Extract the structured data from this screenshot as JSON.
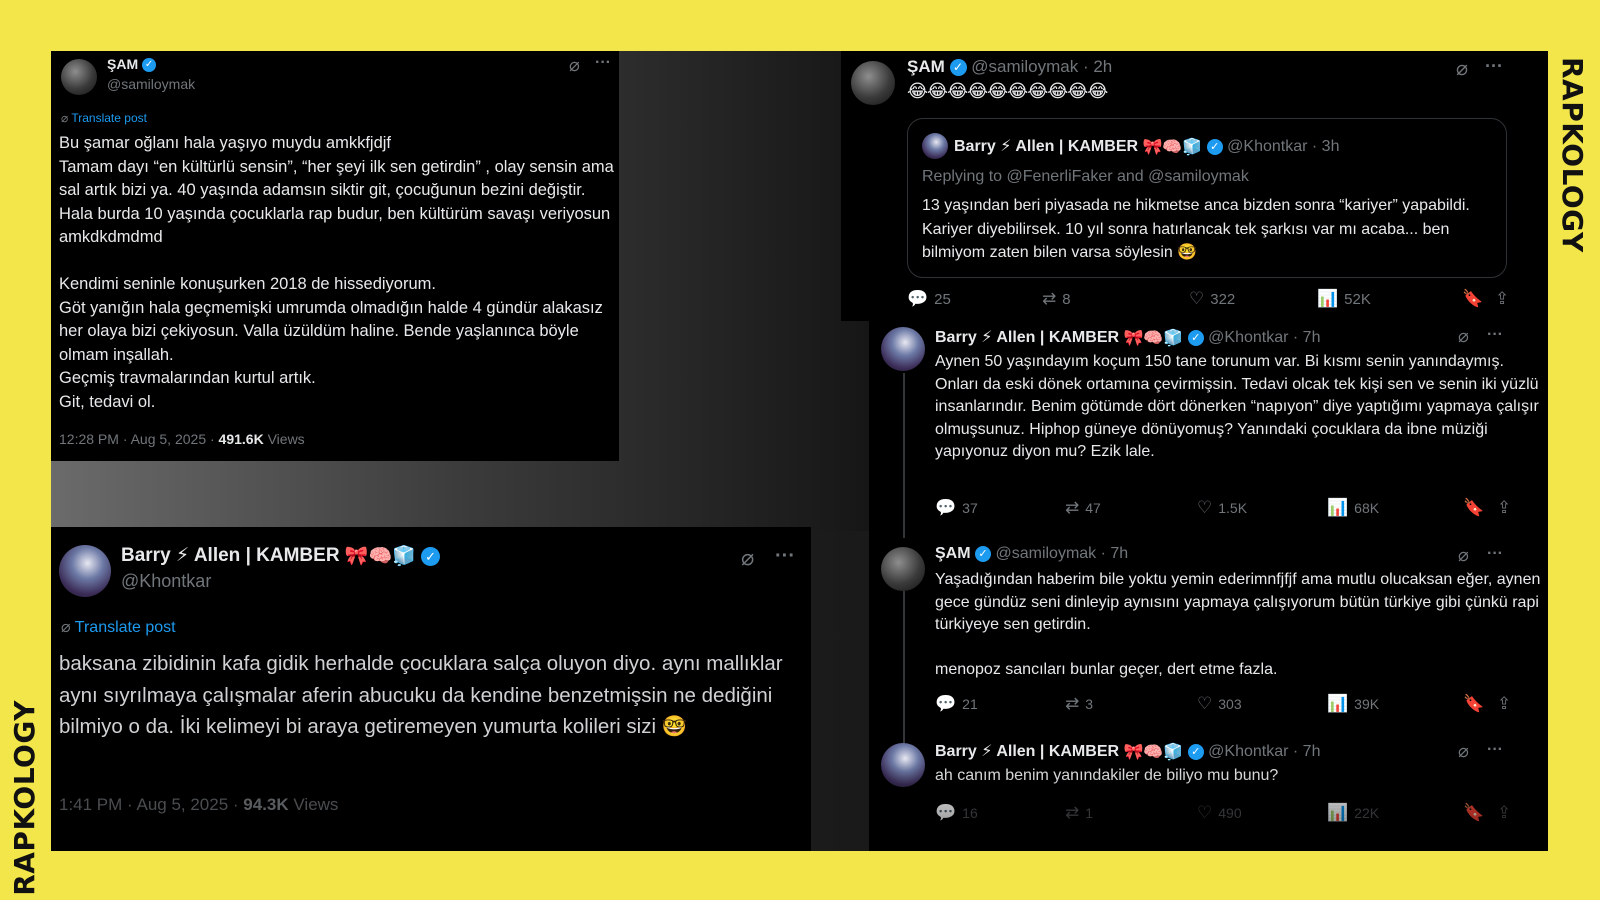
{
  "brand": {
    "text": "RAPKOLOGY"
  },
  "post_left_top": {
    "name": "ŞAM",
    "handle": "@samiloymak",
    "translate": "Translate post",
    "body": "Bu şamar oğlanı hala yaşıyo muydu amkkfjdjf\nTamam dayı “en kültürlü sensin”, “her şeyi ilk sen getirdin” , olay sensin ama sal artık bizi ya. 40 yaşında adamsın siktir git, çocuğunun bezini değiştir. Hala burda 10 yaşında çocuklarla rap budur, ben kültürüm savaşı veriyosun amkdkdmdmd\n\nKendimi seninle konuşurken 2018 de hissediyorum.\nGöt yanığın hala geçmemişki umrumda olmadığın halde 4 gündür alakasız her olaya bizi çekiyosun. Valla üzüldüm haline. Bende yaşlanınca böyle olmam inşallah.\nGeçmiş travmalarından kurtul artık.\nGit, tedavi ol.",
    "timestamp": "12:28 PM · Aug 5, 2025 · ",
    "views_count": "491.6K",
    "views_label": " Views"
  },
  "post_left_bottom": {
    "name": "Barry ⚡ Allen | KAMBER",
    "badges": "🎀🧠🧊",
    "handle": "@Khontkar",
    "translate": "Translate post",
    "body": "baksana zibidinin kafa gidik herhalde çocuklara salça oluyon diyo. aynı mallıklar aynı sıyrılmaya çalışmalar aferin abucuku da kendine benzetmişsin ne dediğini bilmiyo o da. İki kelimeyi bi araya getiremeyen yumurta kolileri sizi 🤓",
    "timestamp": "1:41 PM · Aug 5, 2025 · ",
    "views_count": "94.3K",
    "views_label": " Views"
  },
  "post_right_main": {
    "name": "ŞAM",
    "handle": "@samiloymak · 2h",
    "emojis": "😂😂😂😂😂😂😂😂😂😂",
    "quote": {
      "name": "Barry ⚡ Allen | KAMBER",
      "badges": "🎀🧠🧊",
      "handle": "@Khontkar · 3h",
      "replying": "Replying to @FenerliFaker and @samiloymak",
      "body": "13 yaşından beri piyasada ne hikmetse anca bizden sonra “kariyer” yapabildi. Kariyer diyebilirsek. 10 yıl sonra hatırlancak tek şarkısı var mı acaba... ben bilmiyom zaten bilen varsa söylesin 🤓"
    },
    "stats": {
      "replies": "25",
      "reposts": "8",
      "likes": "322",
      "views": "52K"
    }
  },
  "reply_1": {
    "name": "Barry ⚡ Allen | KAMBER",
    "badges": "🎀🧠🧊",
    "handle": "@Khontkar · 7h",
    "body": "Aynen 50 yaşındayım koçum 150 tane torunum var.  Bi kısmı senin yanındaymış. Onları da eski dönek ortamına çevirmişsin. Tedavi olcak tek kişi sen ve senin iki yüzlü insanlarındır. Benim götümde dört dönerken “napıyon” diye yaptığımı yapmaya çalışır olmuşsunuz. Hiphop güneye dönüyomuş? Yanındaki çocuklara da ibne müziği yapıyonuz diyon mu? Ezik lale.",
    "stats": {
      "replies": "37",
      "reposts": "47",
      "likes": "1.5K",
      "views": "68K"
    }
  },
  "reply_2": {
    "name": "ŞAM",
    "handle": "@samiloymak · 7h",
    "body": "Yaşadığından haberim bile yoktu yemin ederimnfjfjf  ama mutlu olucaksan eğer, aynen gece gündüz seni dinleyip aynısını yapmaya çalışıyorum bütün türkiye gibi çünkü rapi türkiyeye sen getirdin.\n\nmenopoz sancıları bunlar geçer, dert etme fazla.",
    "stats": {
      "replies": "21",
      "reposts": "3",
      "likes": "303",
      "views": "39K"
    }
  },
  "reply_3": {
    "name": "Barry ⚡ Allen | KAMBER",
    "badges": "🎀🧠🧊",
    "handle": "@Khontkar · 7h",
    "body": "ah canım benim yanındakiler de biliyo mu bunu?",
    "stats": {
      "replies": "16",
      "reposts": "1",
      "likes": "490",
      "views": "22K"
    }
  },
  "icons": {
    "grok": "⌀",
    "more": "···",
    "translate": "⌀",
    "verified": "✓",
    "reply": "💬",
    "repost": "⇄",
    "like": "♡",
    "views": "📊",
    "bookmark": "🔖",
    "share": "⇪"
  },
  "colors": {
    "background": "#f2e64a",
    "verified": "#1d9bf0",
    "muted": "#71767b",
    "text": "#e7e9ea"
  }
}
